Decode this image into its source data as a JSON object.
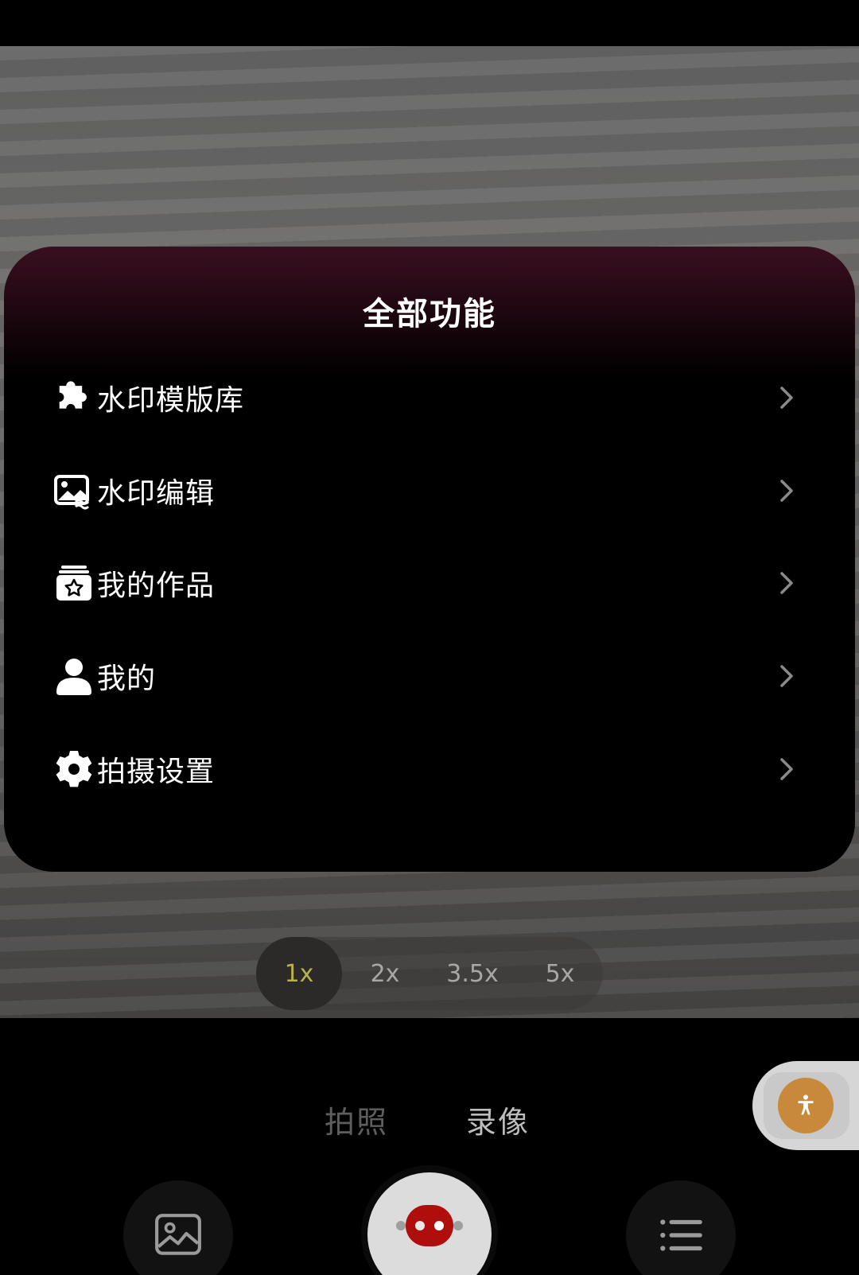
{
  "panel": {
    "title": "全部功能",
    "items": [
      {
        "label": "水印模版库",
        "icon": "puzzle-icon"
      },
      {
        "label": "水印编辑",
        "icon": "image-edit-icon"
      },
      {
        "label": "我的作品",
        "icon": "works-icon"
      },
      {
        "label": "我的",
        "icon": "user-icon"
      },
      {
        "label": "拍摄设置",
        "icon": "gear-icon"
      }
    ]
  },
  "zoom": {
    "options": [
      "1x",
      "2x",
      "3.5x",
      "5x"
    ],
    "selected": "1x"
  },
  "modes": {
    "photo": "拍照",
    "video": "录像",
    "selected": "录像"
  },
  "colors": {
    "accent_zoom": "#b7b34a",
    "shutter_red": "#b00d0d",
    "float_button": "#c8893a",
    "panel_top": "#3a0f1f"
  }
}
